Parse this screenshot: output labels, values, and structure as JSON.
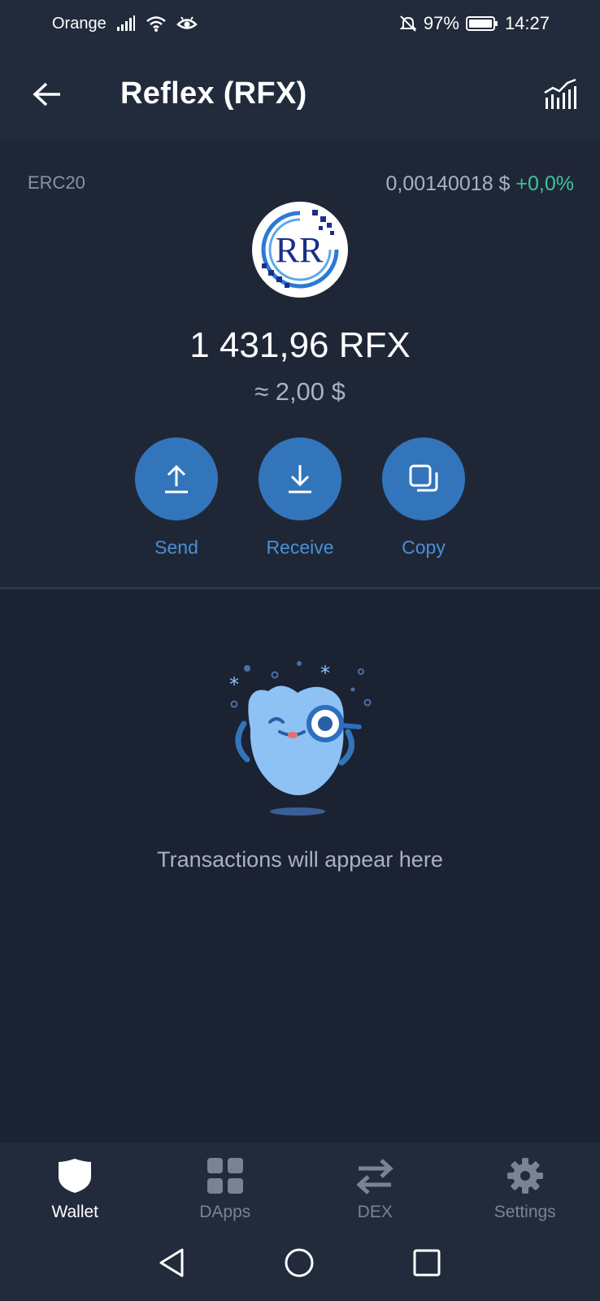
{
  "status_bar": {
    "carrier": "Orange",
    "battery_percent": "97%",
    "time": "14:27",
    "icons": [
      "signal-icon",
      "wifi-icon",
      "eye-icon",
      "bell-off-icon",
      "battery-icon"
    ]
  },
  "header": {
    "title": "Reflex (RFX)",
    "back_icon": "arrow-left-icon",
    "chart_icon": "chart-icon"
  },
  "token": {
    "network": "ERC20",
    "price": "0,00140018 $",
    "change": "+0,0%",
    "balance": "1 431,96 RFX",
    "fiat_value": "≈ 2,00 $",
    "logo": "reflex-logo"
  },
  "actions": [
    {
      "label": "Send",
      "icon": "upload-icon"
    },
    {
      "label": "Receive",
      "icon": "download-icon"
    },
    {
      "label": "Copy",
      "icon": "copy-icon"
    }
  ],
  "empty_state": {
    "message": "Transactions will appear here"
  },
  "bottom_nav": [
    {
      "label": "Wallet",
      "icon": "shield-icon",
      "active": true
    },
    {
      "label": "DApps",
      "icon": "grid-icon",
      "active": false
    },
    {
      "label": "DEX",
      "icon": "swap-icon",
      "active": false
    },
    {
      "label": "Settings",
      "icon": "gear-icon",
      "active": false
    }
  ],
  "colors": {
    "background": "#1b2232",
    "panel": "#1f2737",
    "bar": "#222b3b",
    "accent": "#3375bb",
    "accent_text": "#4a8fd6",
    "positive": "#3fc39b"
  }
}
